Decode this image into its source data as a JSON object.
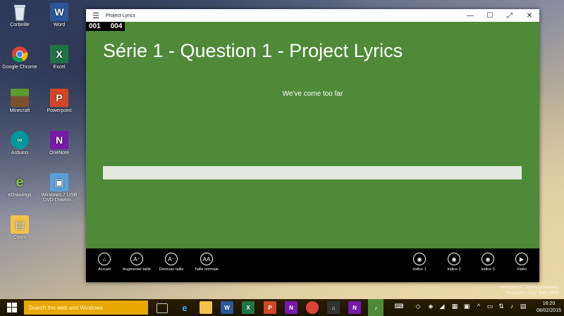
{
  "desktop": {
    "icons": [
      {
        "label": "Corbeille"
      },
      {
        "label": "Word"
      },
      {
        "label": "Google Chrome"
      },
      {
        "label": "Excel"
      },
      {
        "label": "Minecraft"
      },
      {
        "label": "Powerpoint"
      },
      {
        "label": "Arduino"
      },
      {
        "label": "OneNote"
      },
      {
        "label": "eDrawings"
      },
      {
        "label": "Windows 7 USB DVD Downlo..."
      },
      {
        "label": "Cours"
      }
    ]
  },
  "window": {
    "title": "Project Lyrics",
    "counter_left": "001",
    "counter_right": "004",
    "heading": "Série 1 - Question 1 - Project Lyrics",
    "lyric": "We've come too far",
    "answer_value": ""
  },
  "appbar": {
    "left": [
      {
        "label": "Accueil",
        "glyph": "⌂"
      },
      {
        "label": "Augmenter taille",
        "glyph": "A⁺"
      },
      {
        "label": "Diminuer taille",
        "glyph": "A⁻"
      },
      {
        "label": "Taille normale",
        "glyph": "AA"
      }
    ],
    "right": [
      {
        "label": "Indice 1",
        "glyph": "◉"
      },
      {
        "label": "Indice 2",
        "glyph": "◉"
      },
      {
        "label": "Indice 3",
        "glyph": "◉"
      },
      {
        "label": "Vidéo",
        "glyph": "▶"
      }
    ]
  },
  "taskbar": {
    "search_placeholder": "Search the web and Windows",
    "time": "16:20",
    "date": "08/02/2015"
  },
  "watermark": {
    "line1": "Windows 10 Technical Preview",
    "line2": "Evaluation copy. Build 9926"
  }
}
